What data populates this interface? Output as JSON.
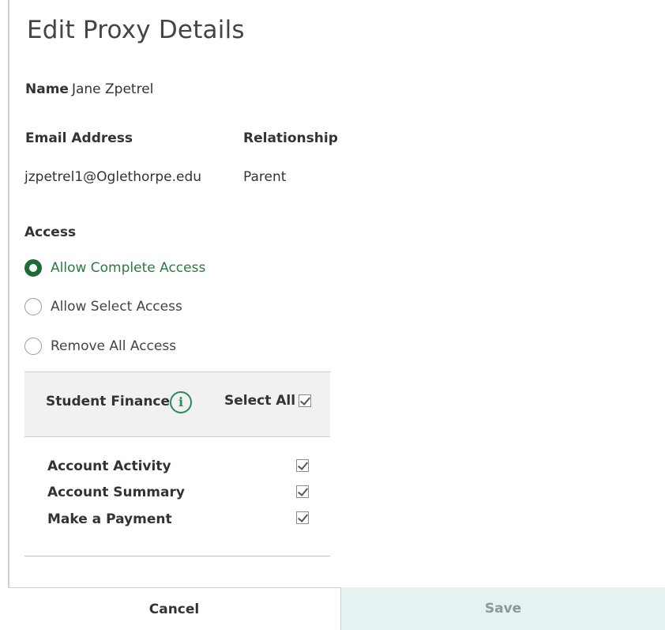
{
  "dialog": {
    "title": "Edit Proxy Details",
    "name_label": "Name",
    "name_value": "Jane Zpetrel",
    "email_label": "Email Address",
    "email_value": "jzpetrel1@Oglethorpe.edu",
    "relationship_label": "Relationship",
    "relationship_value": "Parent",
    "access_label": "Access",
    "access_options": [
      {
        "label": "Allow Complete Access",
        "selected": true
      },
      {
        "label": "Allow Select Access",
        "selected": false
      },
      {
        "label": "Remove All Access",
        "selected": false
      }
    ],
    "section": {
      "title": "Student Finance",
      "info_icon": "info-icon",
      "select_all_label": "Select All",
      "select_all_checked": true,
      "items": [
        {
          "label": "Account Activity",
          "checked": true
        },
        {
          "label": "Account Summary",
          "checked": true
        },
        {
          "label": "Make a Payment",
          "checked": true
        }
      ]
    },
    "footer": {
      "cancel_label": "Cancel",
      "save_label": "Save"
    }
  },
  "colors": {
    "accent_green": "#1e6b3a",
    "selected_text": "#2a7a45",
    "save_bg": "#e6f1f1"
  }
}
